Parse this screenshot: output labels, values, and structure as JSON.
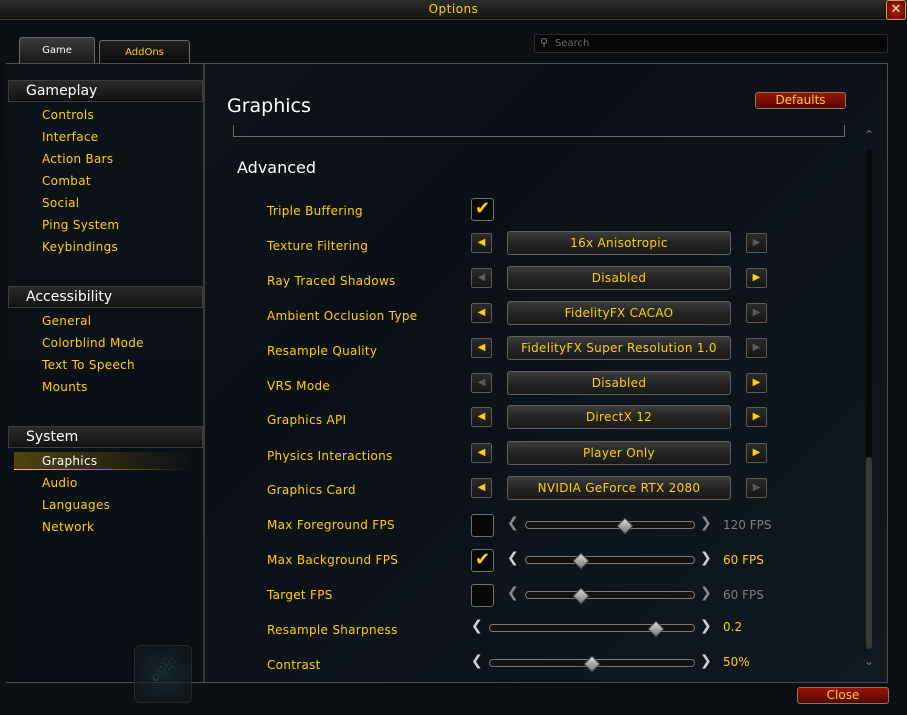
{
  "window": {
    "title": "Options",
    "close_glyph": "✕"
  },
  "tabs": [
    {
      "label": "Game",
      "active": true
    },
    {
      "label": "AddOns",
      "active": false
    }
  ],
  "search": {
    "placeholder": "Search",
    "value": ""
  },
  "sidebar": {
    "categories": [
      {
        "label": "Gameplay",
        "items": [
          "Controls",
          "Interface",
          "Action Bars",
          "Combat",
          "Social",
          "Ping System",
          "Keybindings"
        ]
      },
      {
        "label": "Accessibility",
        "items": [
          "General",
          "Colorblind Mode",
          "Text To Speech",
          "Mounts"
        ]
      },
      {
        "label": "System",
        "items": [
          "Graphics",
          "Audio",
          "Languages",
          "Network"
        ],
        "selected": "Graphics"
      }
    ]
  },
  "main": {
    "title": "Graphics",
    "defaults_label": "Defaults",
    "section_title": "Advanced",
    "rows": {
      "triple_buffering": {
        "label": "Triple Buffering",
        "checked": true
      },
      "texture_filtering": {
        "label": "Texture Filtering",
        "value": "16x Anisotropic"
      },
      "ray_traced_shadows": {
        "label": "Ray Traced Shadows",
        "value": "Disabled"
      },
      "ambient_occlusion": {
        "label": "Ambient Occlusion Type",
        "value": "FidelityFX CACAO"
      },
      "resample_quality": {
        "label": "Resample Quality",
        "value": "FidelityFX Super Resolution 1.0"
      },
      "vrs_mode": {
        "label": "VRS Mode",
        "value": "Disabled"
      },
      "graphics_api": {
        "label": "Graphics API",
        "value": "DirectX 12"
      },
      "physics_interactions": {
        "label": "Physics Interactions",
        "value": "Player Only"
      },
      "graphics_card": {
        "label": "Graphics Card",
        "value": "NVIDIA GeForce RTX 2080"
      },
      "max_foreground_fps": {
        "label": "Max Foreground FPS",
        "checked": false,
        "value_text": "120 FPS",
        "level": 0.6
      },
      "max_background_fps": {
        "label": "Max Background FPS",
        "checked": true,
        "value_text": "60 FPS",
        "level": 0.3
      },
      "target_fps": {
        "label": "Target FPS",
        "checked": false,
        "value_text": "60 FPS",
        "level": 0.3
      },
      "resample_sharpness": {
        "label": "Resample Sharpness",
        "value_text": "0.2",
        "level": 0.85
      },
      "contrast": {
        "label": "Contrast",
        "value_text": "50%",
        "level": 0.5
      }
    }
  },
  "footer": {
    "close_label": "Close"
  },
  "icons": {
    "check": "✔",
    "left": "◀",
    "right": "▶",
    "slider_left": "❮",
    "slider_right": "❯",
    "scroll_up": "⌃",
    "scroll_down": "⌄",
    "search": "⚲"
  },
  "colors": {
    "accent": "#ffd100",
    "button_red": "#9a1408",
    "text_white": "#ffffff"
  }
}
